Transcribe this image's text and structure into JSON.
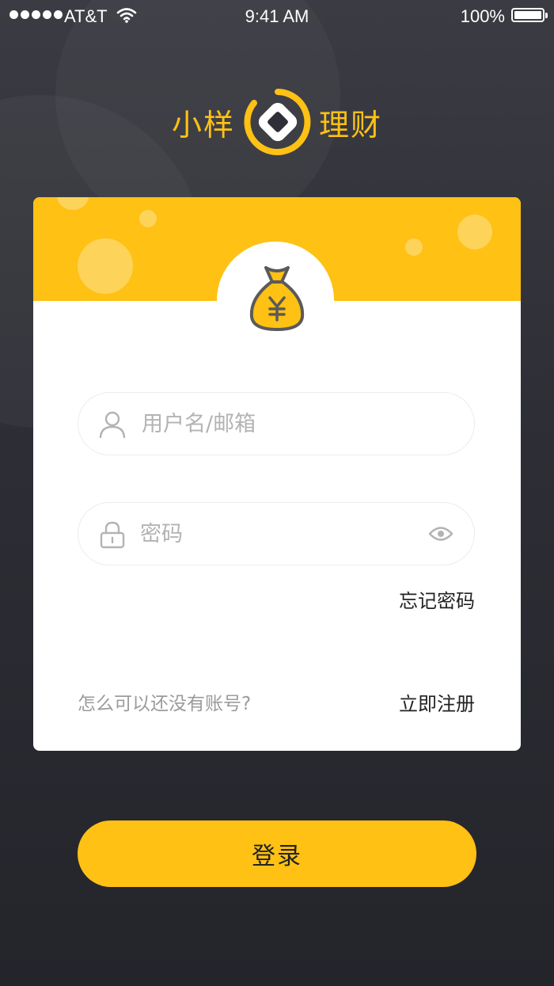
{
  "status_bar": {
    "carrier": "AT&T",
    "time": "9:41 AM",
    "battery": "100%"
  },
  "brand": {
    "left_text": "小样",
    "right_text": "理财"
  },
  "form": {
    "username_placeholder": "用户名/邮箱",
    "password_placeholder": "密码",
    "forgot_password": "忘记密码",
    "no_account": "怎么可以还没有账号?",
    "register": "立即注册",
    "login": "登录"
  },
  "colors": {
    "accent": "#fec114",
    "background": "#2d2e35",
    "card": "#ffffff"
  },
  "icons": [
    "signal-dots-icon",
    "wifi-icon",
    "battery-icon",
    "brand-logo-icon",
    "money-bag-icon",
    "user-icon",
    "lock-icon",
    "eye-icon"
  ]
}
